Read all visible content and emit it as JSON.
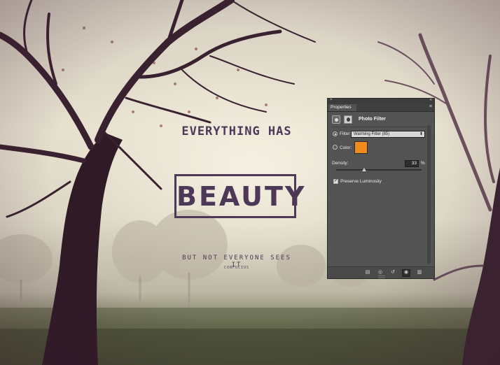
{
  "poster": {
    "headline_top": "EVERYTHING HAS",
    "headline_main": "BEAUTY",
    "subline": "BUT NOT EVERYONE SEES IT",
    "author": "CONFUCIUS",
    "text_color": "#4e3857"
  },
  "panel": {
    "close_glyph": "×",
    "collapse_glyph": "«",
    "tab_label": "Properties",
    "menu_glyph": "≡",
    "title": "Photo Filter",
    "filter_label": "Filter:",
    "filter_value": "Warming Filter (85)",
    "filter_selected": true,
    "color_label": "Color:",
    "color_value": "#f08b1d",
    "density_label": "Density:",
    "density_value": "33",
    "density_unit": "%",
    "density_fraction": 0.33,
    "preserve_luminosity_label": "Preserve Luminosity",
    "preserve_luminosity_checked": true,
    "footer_icons": [
      "clip-to-layer-icon",
      "view-previous-state-icon",
      "reset-icon",
      "visibility-icon",
      "trash-icon"
    ]
  }
}
